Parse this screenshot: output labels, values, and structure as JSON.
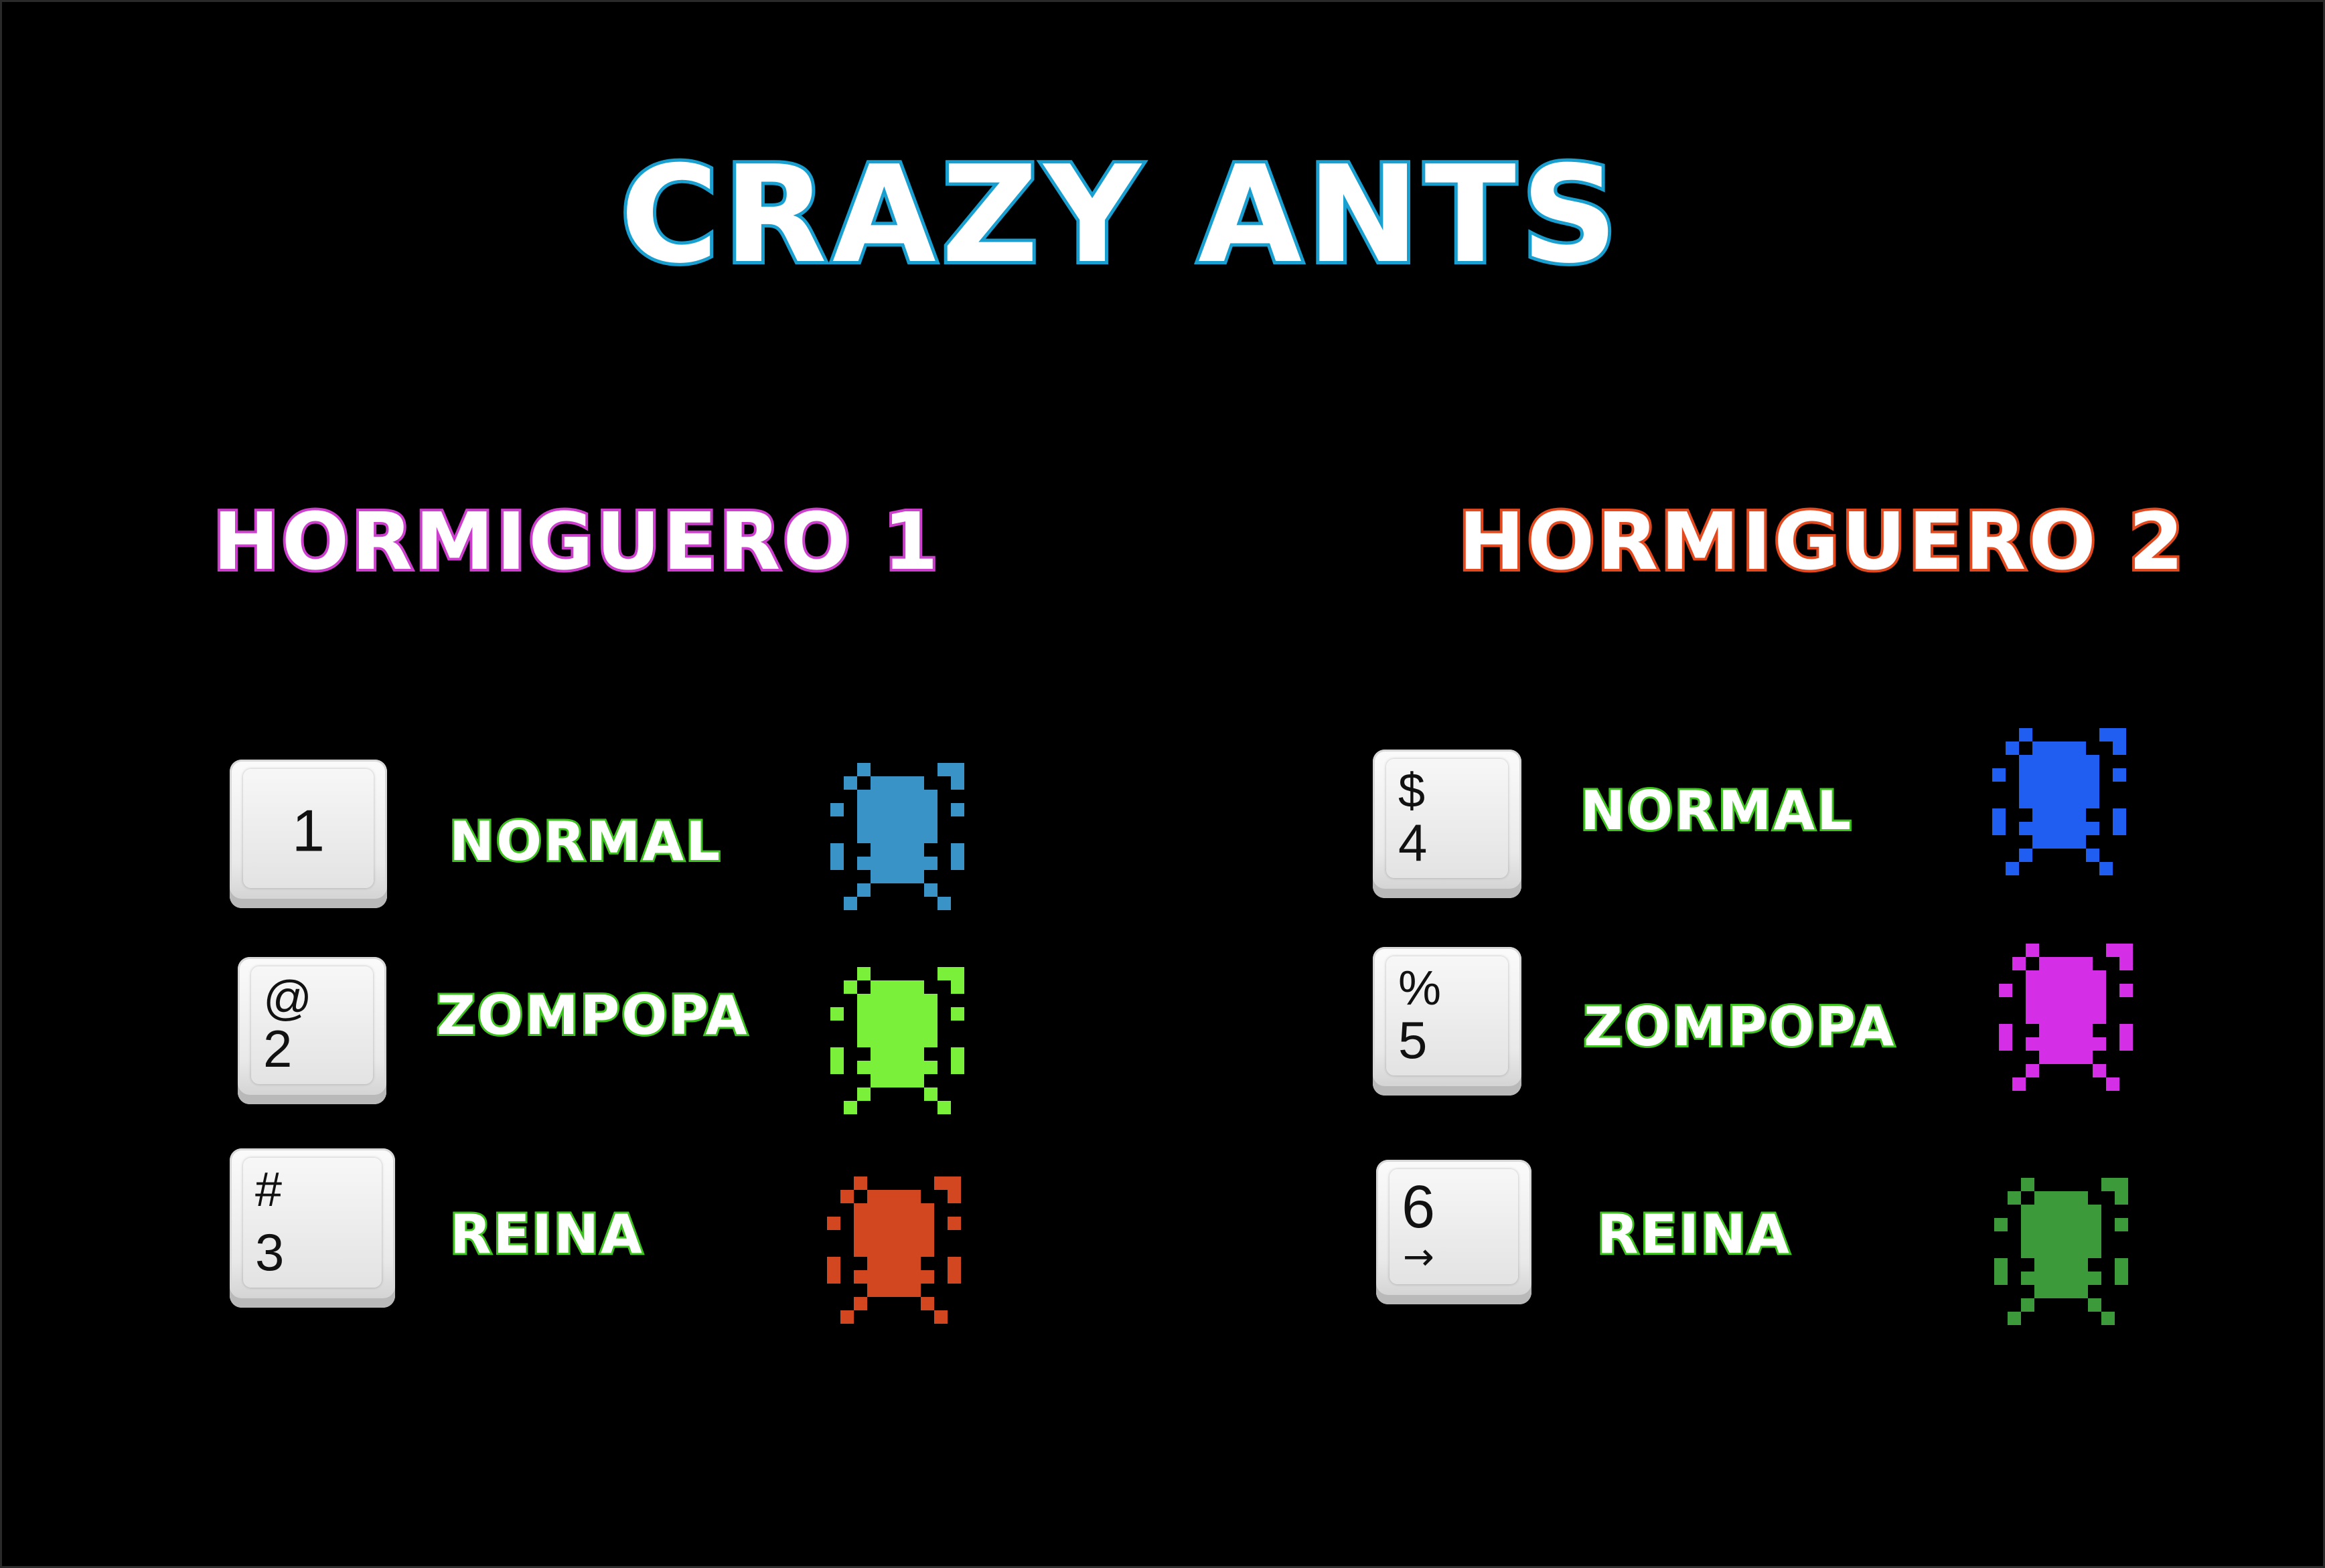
{
  "title": "CRAZY ANTS",
  "groups": [
    {
      "title": "HORMIGUERO 1",
      "rows": [
        {
          "key_top": "",
          "key_main": "1",
          "label": "NORMAL",
          "ant_color": "#3a93c7"
        },
        {
          "key_top": "@",
          "key_main": "2",
          "label": "ZOMPOPA",
          "ant_color": "#7af03a"
        },
        {
          "key_top": "#",
          "key_main": "3",
          "label": "REINA",
          "ant_color": "#d2471f"
        }
      ]
    },
    {
      "title": "HORMIGUERO 2",
      "rows": [
        {
          "key_top": "$",
          "key_main": "4",
          "label": "NORMAL",
          "ant_color": "#1f5ef0"
        },
        {
          "key_top": "%",
          "key_main": "5",
          "label": "ZOMPOPA",
          "ant_color": "#d42ee6"
        },
        {
          "key_top": "6",
          "key_main": "→",
          "label": "REINA",
          "ant_color": "#3d9a3b"
        }
      ]
    }
  ]
}
